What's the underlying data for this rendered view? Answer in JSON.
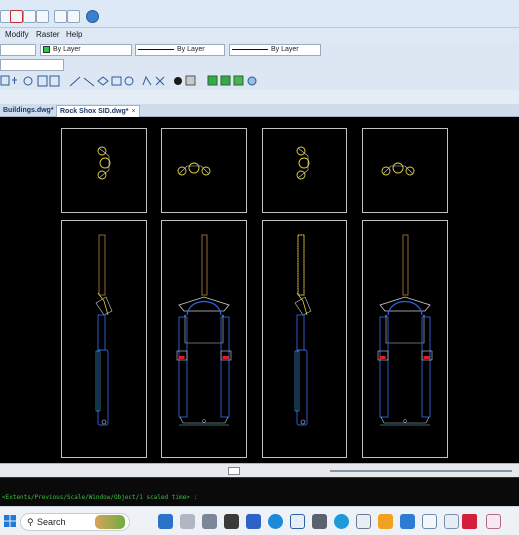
{
  "menubar": {
    "items": [
      "Modify",
      "Raster",
      "Help"
    ]
  },
  "layer_bar": {
    "layer_combo": "By Layer",
    "linetype_combo": "By Layer",
    "lineweight_combo": "By Layer"
  },
  "tabs": [
    {
      "label": "Buildings.dwg*",
      "active": false
    },
    {
      "label": "Rock Shox SID.dwg*",
      "active": true,
      "close": "×"
    }
  ],
  "command_line": {
    "text": "<Extents/Previous/Scale/Window/Object/1 scaled time> :"
  },
  "taskbar": {
    "search_label": "Search"
  },
  "colors": {
    "outline": "#f2f2f2",
    "yellow": "#e3d43a",
    "blue": "#2f63e0",
    "red": "#e02020",
    "cyan": "#4fd6e8",
    "brown": "#b7823a"
  }
}
